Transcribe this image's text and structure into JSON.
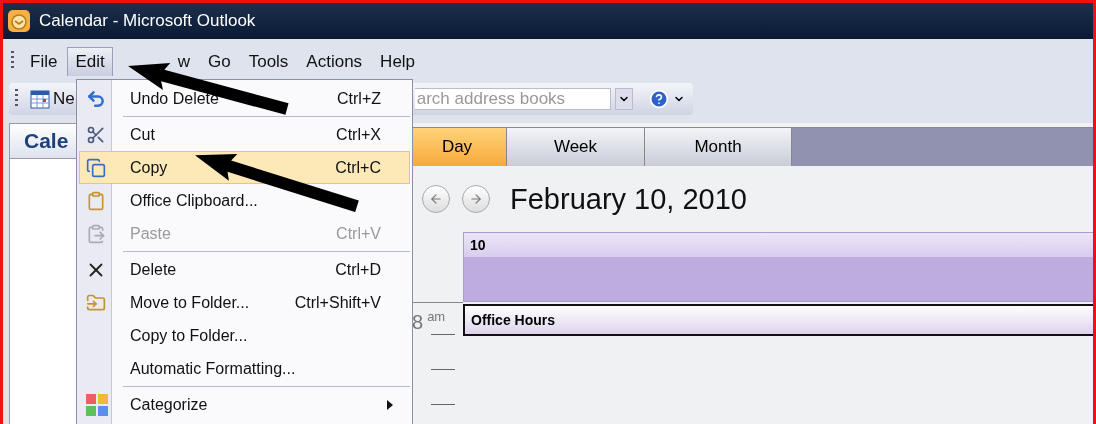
{
  "window": {
    "title": "Calendar - Microsoft Outlook"
  },
  "menu_bar": [
    {
      "label": "File",
      "selected": false
    },
    {
      "label": "Edit",
      "selected": true
    },
    {
      "label": "w",
      "selected": false
    },
    {
      "label": "Go",
      "selected": false
    },
    {
      "label": "Tools",
      "selected": false
    },
    {
      "label": "Actions",
      "selected": false
    },
    {
      "label": "Help",
      "selected": false
    }
  ],
  "toolbar": {
    "new_button": "Ne",
    "search": {
      "placeholder": "arch address books"
    }
  },
  "navigation_pane": {
    "title": "Cale"
  },
  "view_tabs": [
    {
      "label": "Day",
      "selected": true
    },
    {
      "label": "Week",
      "selected": false
    },
    {
      "label": "Month",
      "selected": false
    }
  ],
  "date_header": "February 10, 2010",
  "day_column": {
    "day": "10"
  },
  "time_slots": [
    {
      "hour": "8",
      "period": "am"
    }
  ],
  "appointments": [
    {
      "title": "Office Hours"
    }
  ],
  "edit_menu": [
    {
      "kind": "item",
      "label": "Undo Delete",
      "shortcut": "Ctrl+Z",
      "selected": false,
      "disabled": false,
      "submenu": false
    },
    {
      "kind": "separator"
    },
    {
      "kind": "item",
      "label": "Cut",
      "shortcut": "Ctrl+X",
      "selected": false,
      "disabled": false,
      "submenu": false
    },
    {
      "kind": "item",
      "label": "Copy",
      "shortcut": "Ctrl+C",
      "selected": true,
      "disabled": false,
      "submenu": false
    },
    {
      "kind": "item",
      "label": "Office Clipboard...",
      "selected": false,
      "disabled": false,
      "submenu": false
    },
    {
      "kind": "item",
      "label": "Paste",
      "shortcut": "Ctrl+V",
      "selected": false,
      "disabled": true,
      "submenu": false
    },
    {
      "kind": "separator"
    },
    {
      "kind": "item",
      "label": "Delete",
      "shortcut": "Ctrl+D",
      "selected": false,
      "disabled": false,
      "submenu": false
    },
    {
      "kind": "item",
      "label": "Move to Folder...",
      "shortcut": "Ctrl+Shift+V",
      "selected": false,
      "disabled": false,
      "submenu": false
    },
    {
      "kind": "item",
      "label": "Copy to Folder...",
      "selected": false,
      "disabled": false,
      "submenu": false
    },
    {
      "kind": "item",
      "label": "Automatic Formatting...",
      "selected": false,
      "disabled": false,
      "submenu": false
    },
    {
      "kind": "separator"
    },
    {
      "kind": "item",
      "label": "Categorize",
      "selected": false,
      "disabled": false,
      "submenu": true
    }
  ]
}
